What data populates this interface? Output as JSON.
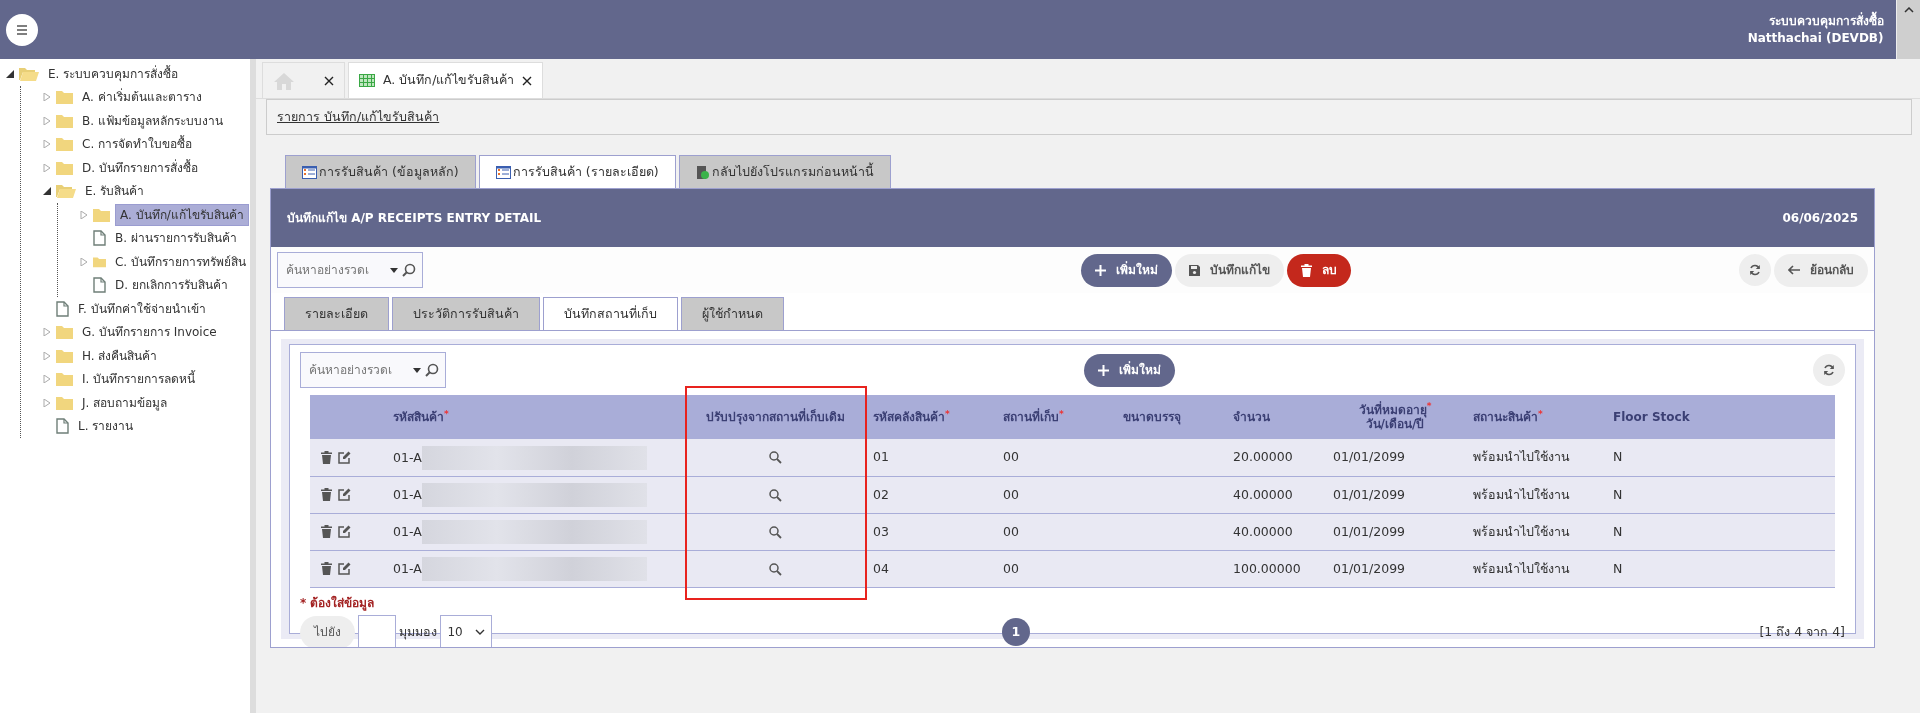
{
  "app": {
    "title": "ระบบควบคุมการสั่งซื้อ",
    "user": "Natthachai (DEVDB)"
  },
  "tree": [
    {
      "label": "E. ระบบควบคุมการสั่งซื้อ",
      "kind": "folder",
      "expanded": true,
      "selected": false,
      "children": [
        {
          "label": "A. ค่าเริ่มต้นและตาราง",
          "kind": "folder",
          "expanded": false,
          "selected": false
        },
        {
          "label": "B. แฟ้มข้อมูลหลักระบบงาน",
          "kind": "folder",
          "expanded": false,
          "selected": false
        },
        {
          "label": "C. การจัดทำใบขอซื้อ",
          "kind": "folder",
          "expanded": false,
          "selected": false
        },
        {
          "label": "D. บันทึกรายการสั่งซื้อ",
          "kind": "folder",
          "expanded": false,
          "selected": false
        },
        {
          "label": "E. รับสินค้า",
          "kind": "folder",
          "expanded": true,
          "selected": false,
          "children": [
            {
              "label": "A. บันทึก/แก้ไขรับสินค้า",
              "kind": "folder",
              "expanded": false,
              "selected": true
            },
            {
              "label": "B. ผ่านรายการรับสินค้า",
              "kind": "file",
              "selected": false
            },
            {
              "label": "C. บันทึกรายการทรัพย์สิน",
              "kind": "folder",
              "expanded": false,
              "selected": false
            },
            {
              "label": "D. ยกเลิกการรับสินค้า",
              "kind": "file",
              "selected": false
            }
          ]
        },
        {
          "label": "F. บันทึกค่าใช้จ่ายนำเข้า",
          "kind": "file",
          "selected": false
        },
        {
          "label": "G. บันทึกรายการ Invoice",
          "kind": "folder",
          "expanded": false,
          "selected": false
        },
        {
          "label": "H. ส่งคืนสินค้า",
          "kind": "folder",
          "expanded": false,
          "selected": false
        },
        {
          "label": "I. บันทึกรายการลดหนี้",
          "kind": "folder",
          "expanded": false,
          "selected": false
        },
        {
          "label": "J. สอบถามข้อมูล",
          "kind": "folder",
          "expanded": false,
          "selected": false
        },
        {
          "label": "L. รายงาน",
          "kind": "file",
          "selected": false
        }
      ]
    }
  ],
  "doc_tabs": [
    {
      "kind": "home",
      "selected": false
    },
    {
      "kind": "page",
      "label": "A. บันทึก/แก้ไขรับสินค้า",
      "selected": true
    }
  ],
  "breadcrumb": "รายการ บันทึก/แก้ไขรับสินค้า",
  "section_tabs": [
    {
      "label": "การรับสินค้า (ข้อมูลหลัก)",
      "kind": "list",
      "selected": false
    },
    {
      "label": "การรับสินค้า (รายละเอียด)",
      "kind": "list",
      "selected": true
    },
    {
      "label": "กลับไปยังโปรแกรมก่อนหน้านี้",
      "kind": "exit",
      "selected": false
    }
  ],
  "panel": {
    "title": "บันทึกแก้ไข A/P RECEIPTS ENTRY DETAIL",
    "date": "06/06/2025"
  },
  "toolbar": {
    "search_placeholder": "ค้นหาอย่างรวดเ",
    "buttons": [
      {
        "label": "เพิ่มใหม่",
        "kind": "add"
      },
      {
        "label": "บันทึกแก้ไข",
        "kind": "save"
      },
      {
        "label": "ลบ",
        "kind": "delete"
      }
    ],
    "back": "ย้อนกลับ"
  },
  "detail_tabs": [
    {
      "label": "รายละเอียด",
      "selected": false
    },
    {
      "label": "ประวัติการรับสินค้า",
      "selected": false
    },
    {
      "label": "บันทึกสถานที่เก็บ",
      "selected": true
    },
    {
      "label": "ผู้ใช้กำหนด",
      "selected": false
    }
  ],
  "grid": {
    "search_placeholder": "ค้นหาอย่างรวดเ",
    "add": "เพิ่มใหม่",
    "columns": [
      {
        "kind": "actions"
      },
      {
        "label": "รหัสสินค้า",
        "mark": "*",
        "kind": "text"
      },
      {
        "label": "ปรับปรุงจากสถานที่เก็บเดิม",
        "kind": "lookup",
        "highlighted": true
      },
      {
        "label": "รหัสคลังสินค้า",
        "mark": "*",
        "kind": "text"
      },
      {
        "label": "สถานที่เก็บ",
        "mark": "*",
        "kind": "text"
      },
      {
        "label": "ขนาดบรรจุ",
        "kind": "text"
      },
      {
        "label": "จำนวน",
        "kind": "text"
      },
      {
        "label": "วันที่หมดอายุ",
        "mark": "*",
        "sub": "วัน/เดือน/ปี",
        "kind": "text"
      },
      {
        "label": "สถานะสินค้า",
        "mark": "*",
        "kind": "text"
      },
      {
        "label": "Floor Stock",
        "kind": "text"
      }
    ],
    "rows": [
      {
        "code": "01-A",
        "redacted": true,
        "warehouse": "01",
        "location": "00",
        "qty": "20.00000",
        "expiry": "01/01/2099",
        "status": "พร้อมนำไปใช้งาน",
        "floor": "N"
      },
      {
        "code": "01-A",
        "redacted": true,
        "warehouse": "02",
        "location": "00",
        "qty": "40.00000",
        "expiry": "01/01/2099",
        "status": "พร้อมนำไปใช้งาน",
        "floor": "N"
      },
      {
        "code": "01-A",
        "redacted": true,
        "warehouse": "03",
        "location": "00",
        "qty": "40.00000",
        "expiry": "01/01/2099",
        "status": "พร้อมนำไปใช้งาน",
        "floor": "N"
      },
      {
        "code": "01-A",
        "redacted": true,
        "warehouse": "04",
        "location": "00",
        "qty": "100.00000",
        "expiry": "01/01/2099",
        "status": "พร้อมนำไปใช้งาน",
        "floor": "N"
      }
    ],
    "required_note": "* ต้องใส่ข้อมูล",
    "pager": {
      "goto": "ไปยัง",
      "view": "มุมมอง",
      "page_size": "10",
      "page": "1",
      "summary": "[1 ถึง 4 จาก 4]"
    }
  }
}
